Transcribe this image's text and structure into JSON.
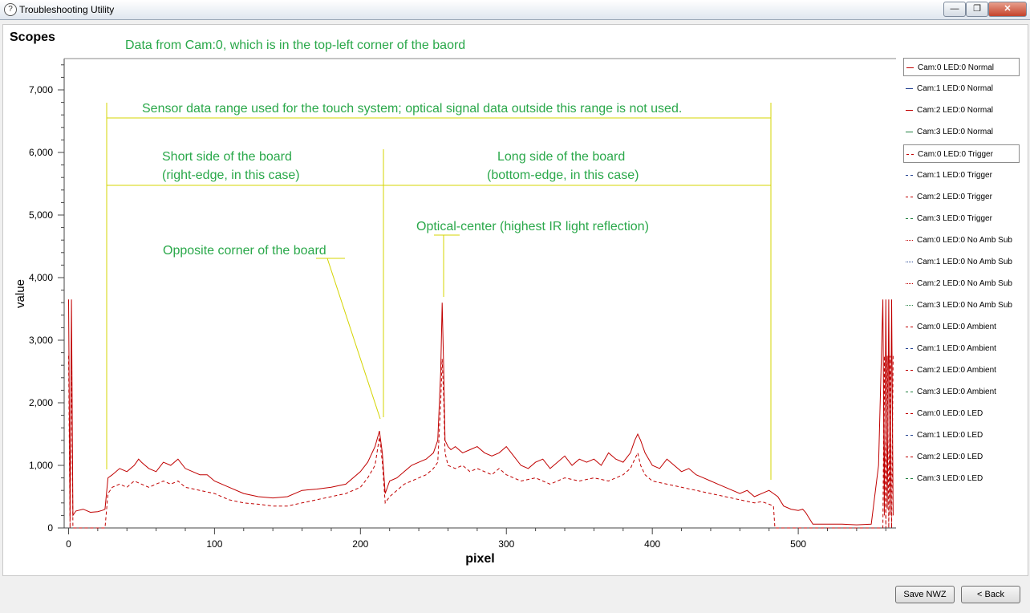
{
  "window": {
    "title": "Troubleshooting Utility",
    "minimize_label": "—",
    "restore_label": "❐",
    "close_label": "✕"
  },
  "panel": {
    "title": "Scopes"
  },
  "legend": [
    {
      "label": "Cam:0 LED:0 Normal",
      "color": "#c00000",
      "dash": "solid"
    },
    {
      "label": "Cam:1 LED:0 Normal",
      "color": "#1f3f8f",
      "dash": "solid"
    },
    {
      "label": "Cam:2 LED:0 Normal",
      "color": "#c00000",
      "dash": "solid"
    },
    {
      "label": "Cam:3 LED:0 Normal",
      "color": "#1f7f3f",
      "dash": "solid"
    },
    {
      "label": "Cam:0 LED:0 Trigger",
      "color": "#c00000",
      "dash": "dashed"
    },
    {
      "label": "Cam:1 LED:0 Trigger",
      "color": "#1f3f8f",
      "dash": "dashed"
    },
    {
      "label": "Cam:2 LED:0 Trigger",
      "color": "#c00000",
      "dash": "dashed"
    },
    {
      "label": "Cam:3 LED:0 Trigger",
      "color": "#1f7f3f",
      "dash": "dashed"
    },
    {
      "label": "Cam:0 LED:0 No Amb Sub",
      "color": "#c00000",
      "dash": "dotted"
    },
    {
      "label": "Cam:1 LED:0 No Amb Sub",
      "color": "#1f3f8f",
      "dash": "dotted"
    },
    {
      "label": "Cam:2 LED:0 No Amb Sub",
      "color": "#c00000",
      "dash": "dotted"
    },
    {
      "label": "Cam:3 LED:0 No Amb Sub",
      "color": "#1f7f3f",
      "dash": "dotted"
    },
    {
      "label": "Cam:0 LED:0 Ambient",
      "color": "#c00000",
      "dash": "dashed"
    },
    {
      "label": "Cam:1 LED:0 Ambient",
      "color": "#1f3f8f",
      "dash": "dashed"
    },
    {
      "label": "Cam:2 LED:0 Ambient",
      "color": "#c00000",
      "dash": "dashed"
    },
    {
      "label": "Cam:3 LED:0 Ambient",
      "color": "#1f7f3f",
      "dash": "dashed"
    },
    {
      "label": "Cam:0 LED:0 LED",
      "color": "#c00000",
      "dash": "dashed"
    },
    {
      "label": "Cam:1 LED:0 LED",
      "color": "#1f3f8f",
      "dash": "dashed"
    },
    {
      "label": "Cam:2 LED:0 LED",
      "color": "#c00000",
      "dash": "dashed"
    },
    {
      "label": "Cam:3 LED:0 LED",
      "color": "#1f7f3f",
      "dash": "dashed"
    }
  ],
  "buttons": {
    "save": "Save NWZ",
    "back": "< Back"
  },
  "chart_data": {
    "type": "line",
    "title": "",
    "xlabel": "pixel",
    "ylabel": "value",
    "xlim": [
      -3,
      567
    ],
    "ylim": [
      0,
      7500
    ],
    "x_ticks": [
      0,
      100,
      200,
      300,
      400,
      500
    ],
    "y_ticks": [
      0,
      1000,
      2000,
      3000,
      4000,
      5000,
      6000,
      7000
    ],
    "y_tick_labels": [
      "0",
      "1,000",
      "2,000",
      "3,000",
      "4,000",
      "5,000",
      "6,000",
      "7,000"
    ],
    "series": [
      {
        "name": "Cam:0 LED:0 Normal",
        "color": "#c00000",
        "dash": "solid",
        "x": [
          0,
          1,
          2,
          3,
          5,
          10,
          15,
          20,
          23,
          25,
          27,
          30,
          35,
          40,
          45,
          48,
          50,
          55,
          60,
          65,
          70,
          75,
          80,
          85,
          90,
          95,
          100,
          110,
          120,
          130,
          140,
          150,
          160,
          170,
          180,
          190,
          200,
          205,
          210,
          213,
          215,
          217,
          220,
          225,
          230,
          235,
          240,
          245,
          250,
          253,
          255,
          256,
          257,
          258,
          260,
          262,
          265,
          270,
          275,
          280,
          285,
          290,
          295,
          300,
          305,
          310,
          315,
          320,
          325,
          330,
          335,
          340,
          345,
          350,
          355,
          360,
          365,
          370,
          375,
          380,
          385,
          388,
          390,
          392,
          395,
          400,
          405,
          410,
          415,
          420,
          425,
          430,
          435,
          440,
          445,
          450,
          455,
          460,
          465,
          470,
          475,
          480,
          483,
          486,
          490,
          495,
          500,
          503,
          505,
          510,
          520,
          530,
          540,
          550,
          555,
          558,
          559,
          560,
          561,
          562,
          563,
          564,
          565
        ],
        "y": [
          3650,
          150,
          3650,
          200,
          270,
          300,
          250,
          260,
          280,
          300,
          800,
          850,
          950,
          900,
          1000,
          1100,
          1050,
          950,
          900,
          1050,
          1000,
          1100,
          950,
          900,
          850,
          850,
          750,
          650,
          550,
          500,
          480,
          500,
          600,
          620,
          650,
          700,
          900,
          1050,
          1300,
          1550,
          1200,
          550,
          750,
          800,
          900,
          1000,
          1050,
          1100,
          1200,
          1400,
          2500,
          3600,
          2600,
          1400,
          1300,
          1250,
          1300,
          1200,
          1250,
          1300,
          1200,
          1150,
          1200,
          1300,
          1150,
          1000,
          950,
          1050,
          1100,
          950,
          1050,
          1150,
          1000,
          1100,
          1050,
          1100,
          1000,
          1200,
          1100,
          1050,
          1200,
          1400,
          1500,
          1400,
          1200,
          1000,
          950,
          1100,
          1000,
          900,
          950,
          850,
          800,
          750,
          700,
          650,
          600,
          550,
          600,
          500,
          550,
          600,
          550,
          500,
          350,
          300,
          280,
          300,
          250,
          60,
          60,
          60,
          50,
          60,
          1000,
          3650,
          200,
          3650,
          300,
          3650,
          200,
          3650,
          200
        ]
      },
      {
        "name": "Cam:0 LED:0 Trigger",
        "color": "#c00000",
        "dash": "dashed",
        "x": [
          0,
          1,
          2,
          3,
          5,
          10,
          20,
          24,
          25,
          27,
          30,
          35,
          40,
          45,
          50,
          55,
          60,
          65,
          70,
          75,
          80,
          90,
          100,
          110,
          120,
          130,
          140,
          150,
          160,
          170,
          180,
          190,
          200,
          205,
          210,
          213,
          215,
          217,
          220,
          225,
          230,
          235,
          240,
          245,
          250,
          253,
          255,
          256,
          257,
          258,
          260,
          265,
          270,
          275,
          280,
          285,
          290,
          295,
          300,
          310,
          320,
          330,
          340,
          350,
          360,
          370,
          380,
          385,
          388,
          390,
          392,
          395,
          400,
          410,
          420,
          430,
          440,
          450,
          460,
          470,
          475,
          480,
          483,
          484,
          490,
          500,
          520,
          540,
          550,
          555,
          558,
          559,
          560,
          561,
          562,
          563,
          564,
          565
        ],
        "y": [
          2750,
          0,
          2750,
          0,
          0,
          0,
          0,
          0,
          0,
          550,
          650,
          700,
          650,
          750,
          700,
          650,
          700,
          750,
          700,
          750,
          650,
          600,
          550,
          450,
          400,
          380,
          350,
          350,
          400,
          450,
          500,
          550,
          650,
          800,
          1000,
          1450,
          1050,
          400,
          500,
          600,
          700,
          750,
          800,
          850,
          950,
          1050,
          2000,
          2700,
          2100,
          1200,
          1000,
          950,
          1000,
          900,
          950,
          900,
          850,
          950,
          850,
          750,
          800,
          700,
          800,
          750,
          800,
          750,
          850,
          950,
          1100,
          1200,
          1000,
          850,
          750,
          700,
          650,
          600,
          550,
          500,
          450,
          400,
          420,
          380,
          350,
          0,
          0,
          0,
          0,
          0,
          0,
          0,
          0,
          2750,
          0,
          2750,
          0,
          2750,
          0,
          2750
        ]
      }
    ],
    "annotations": [
      {
        "text": "Data from Cam:0, which is in the top-left corner of the baord"
      },
      {
        "text": "Sensor data range used for the touch system; optical signal data outside this range is not used."
      },
      {
        "text": "Short  side of the board"
      },
      {
        "text": "(right-edge, in this case)"
      },
      {
        "text": "Long side of the board"
      },
      {
        "text": "(bottom-edge, in this case)"
      },
      {
        "text": "Optical-center (highest IR light reflection)"
      },
      {
        "text": "Opposite corner of the board"
      }
    ]
  }
}
